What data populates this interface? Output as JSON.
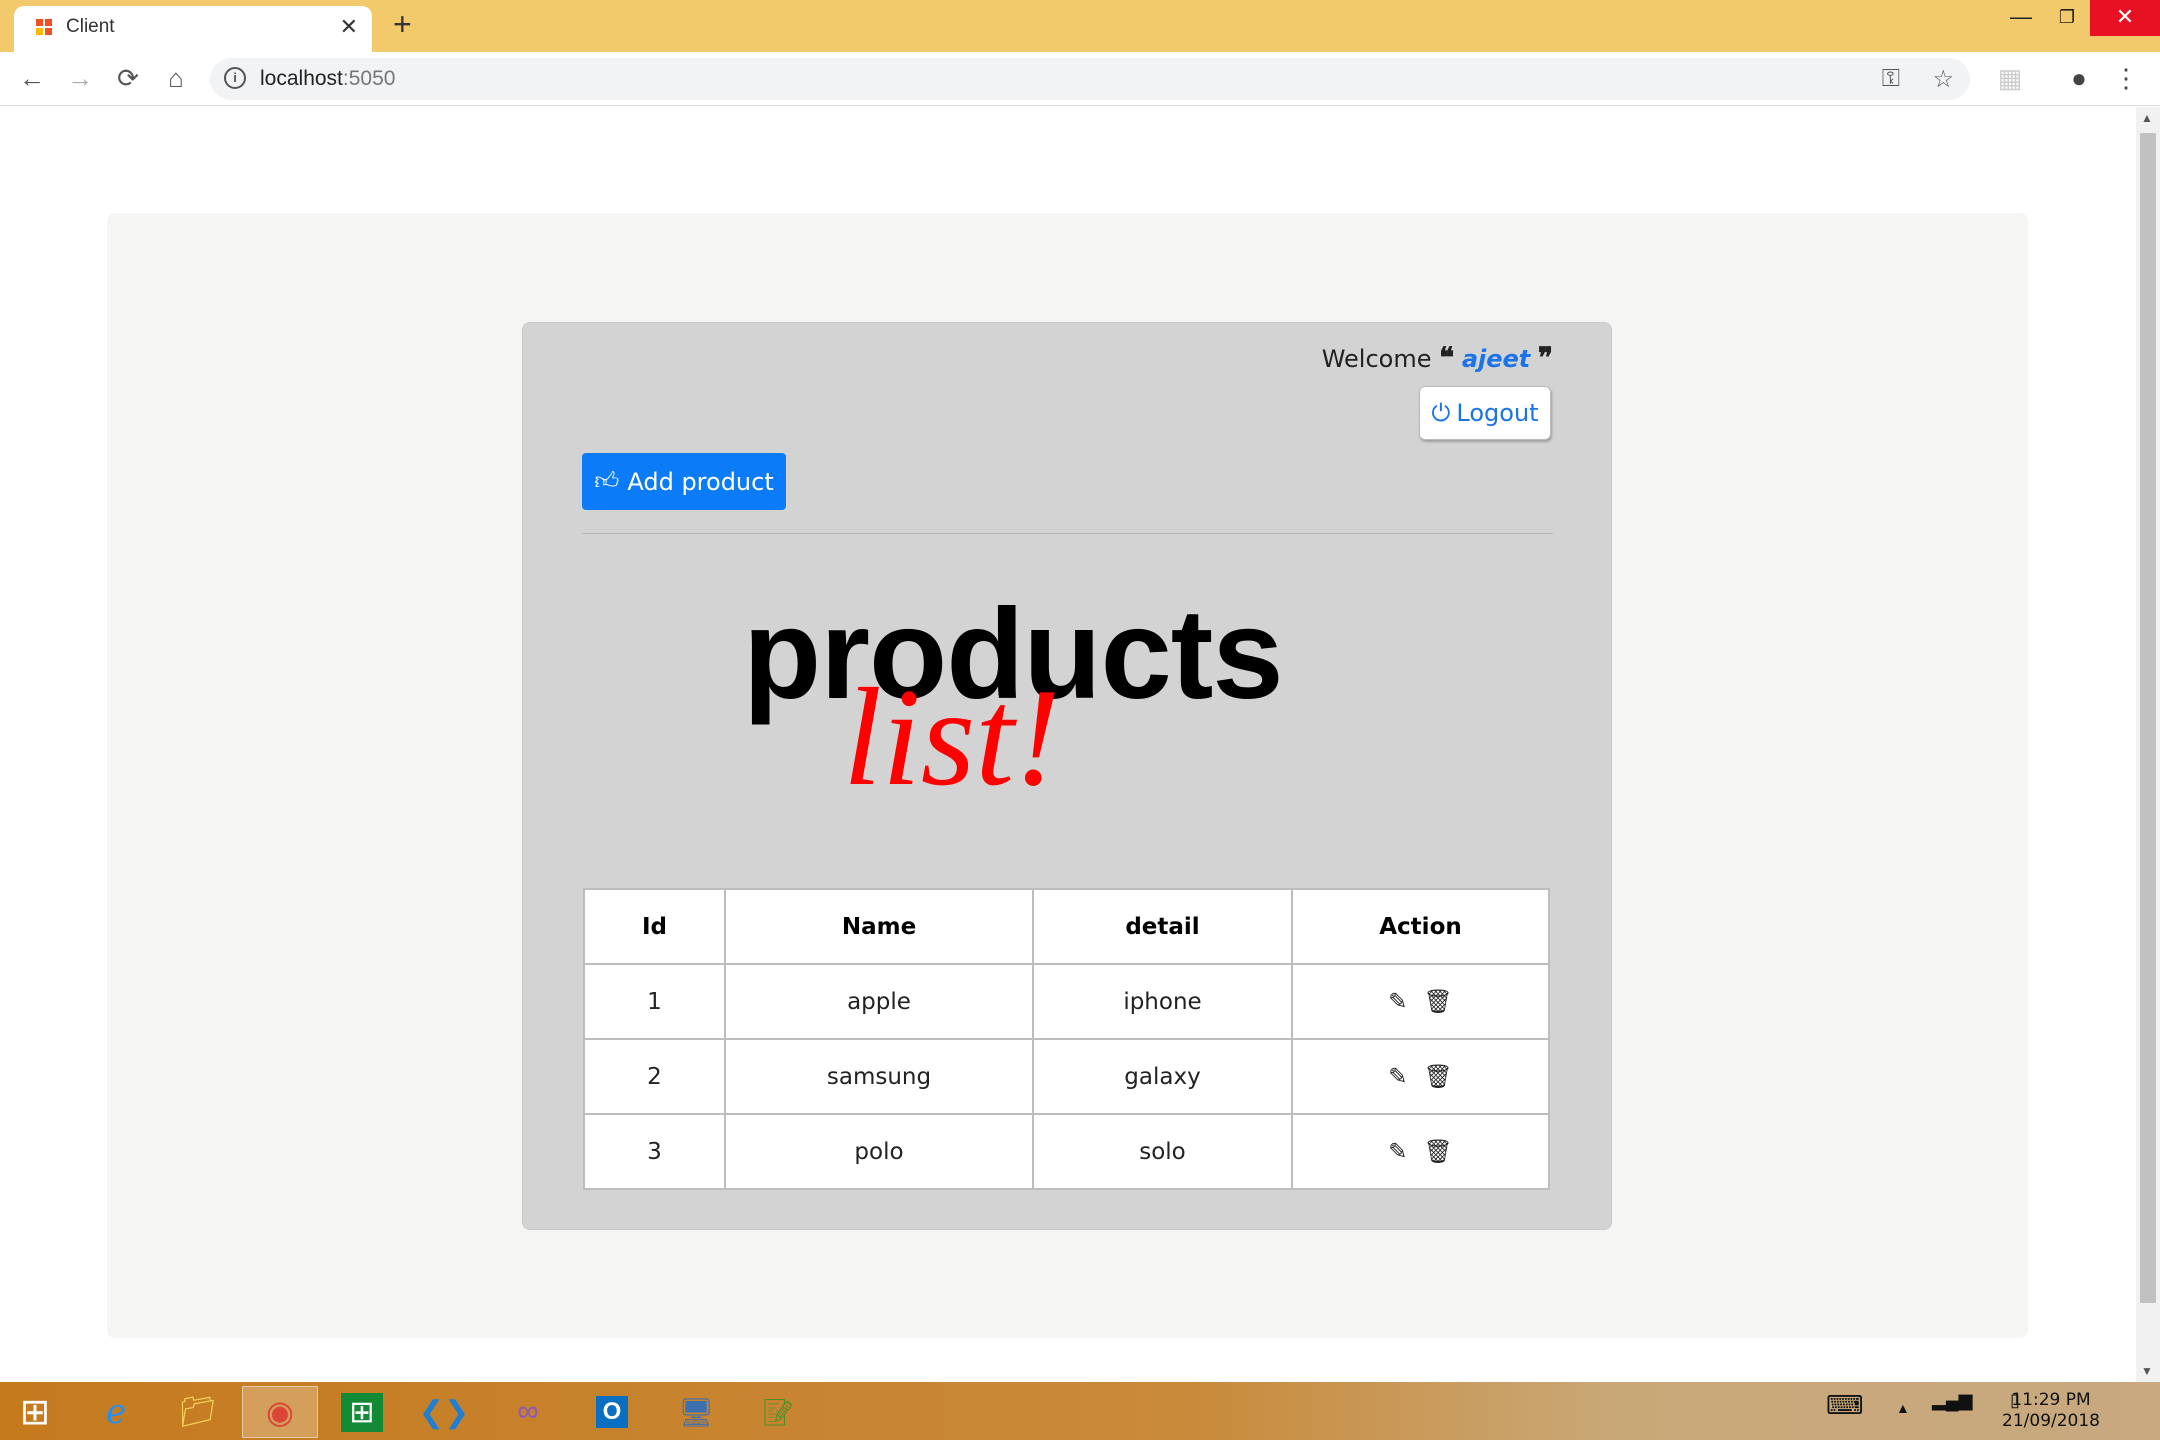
{
  "browser": {
    "tab_title": "Client",
    "url_host": "localhost",
    "url_port": ":5050"
  },
  "header": {
    "welcome_text": "Welcome",
    "username": "ajeet",
    "logout_label": "Logout"
  },
  "toolbar": {
    "add_label": "Add product"
  },
  "title": {
    "main": "products",
    "accent": "list!"
  },
  "table": {
    "columns": [
      "Id",
      "Name",
      "detail",
      "Action"
    ],
    "rows": [
      {
        "id": "1",
        "name": "apple",
        "detail": "iphone"
      },
      {
        "id": "2",
        "name": "samsung",
        "detail": "galaxy"
      },
      {
        "id": "3",
        "name": "polo",
        "detail": "solo"
      }
    ]
  },
  "taskbar": {
    "time": "11:29 PM",
    "date": "21/09/2018"
  },
  "colors": {
    "accent": "#0b7bf7",
    "title_accent": "#ff0000",
    "tabbar": "#f2c96b"
  }
}
